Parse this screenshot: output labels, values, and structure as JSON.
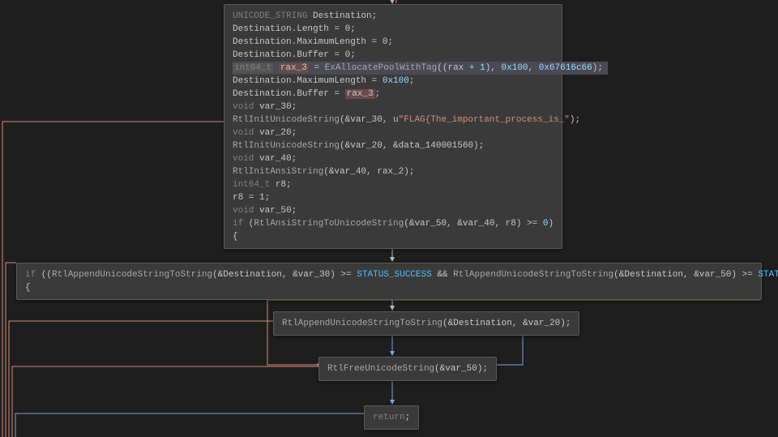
{
  "block1": {
    "l1": {
      "type": "UNICODE_STRING",
      "var": "Destination;"
    },
    "l2": "Destination.Length = 0;",
    "l3": "Destination.MaximumLength = 0;",
    "l4": "Destination.Buffer = 0;",
    "l5": {
      "type": "int64_t",
      "var": "rax_3",
      "a": " = ",
      "fn": "ExAllocatePoolWithTag",
      "args1": "((rax + ",
      "n1": "1",
      "args2": "), ",
      "n2": "0x100",
      "args3": ", ",
      "n3": "0x67616c66",
      "args4": ");"
    },
    "l6": {
      "a": "Destination.MaximumLength = ",
      "n": "0x100",
      "b": ";"
    },
    "l7": {
      "a": "Destination.Buffer = ",
      "v": "rax_3",
      "b": ";"
    },
    "l8": {
      "type": "void",
      "var": "var_30;"
    },
    "l9": {
      "fn": "RtlInitUnicodeString",
      "a": "(&var_30, u",
      "s": "\"FLAG{The_important_process_is_\"",
      "b": ");"
    },
    "l10": {
      "type": "void",
      "var": "var_20;"
    },
    "l11": {
      "fn": "RtlInitUnicodeString",
      "args": "(&var_20, &data_140001560);"
    },
    "l12": {
      "type": "void",
      "var": "var_40;"
    },
    "l13": {
      "fn": "RtlInitAnsiString",
      "args": "(&var_40, rax_2);"
    },
    "l14": {
      "type": "int64_t",
      "var": "r8;"
    },
    "l15": "r8 = 1;",
    "l16": {
      "type": "void",
      "var": "var_50;"
    },
    "l17": {
      "kw": "if",
      "a": " (",
      "fn": "RtlAnsiStringToUnicodeString",
      "args": "(&var_50, &var_40, r8) >= ",
      "n": "0",
      "b": ")"
    },
    "l18": "{"
  },
  "block2": {
    "kw": "if",
    "a": " ((",
    "fn1": "RtlAppendUnicodeStringToString",
    "args1": "(&Destination, &var_30) >= ",
    "c1": "STATUS_SUCCESS",
    "mid": " && ",
    "fn2": "RtlAppendUnicodeStringToString",
    "args2": "(&Destination, &var_50) >= ",
    "c2": "STATUS_SUCCESS",
    "b": "))",
    "l2": "{"
  },
  "block3": {
    "fn": "RtlAppendUnicodeStringToString",
    "args": "(&Destination, &var_20);"
  },
  "block4": {
    "fn": "RtlFreeUnicodeString",
    "args": "(&var_50);"
  },
  "block5": {
    "kw": "return",
    "semi": ";"
  }
}
